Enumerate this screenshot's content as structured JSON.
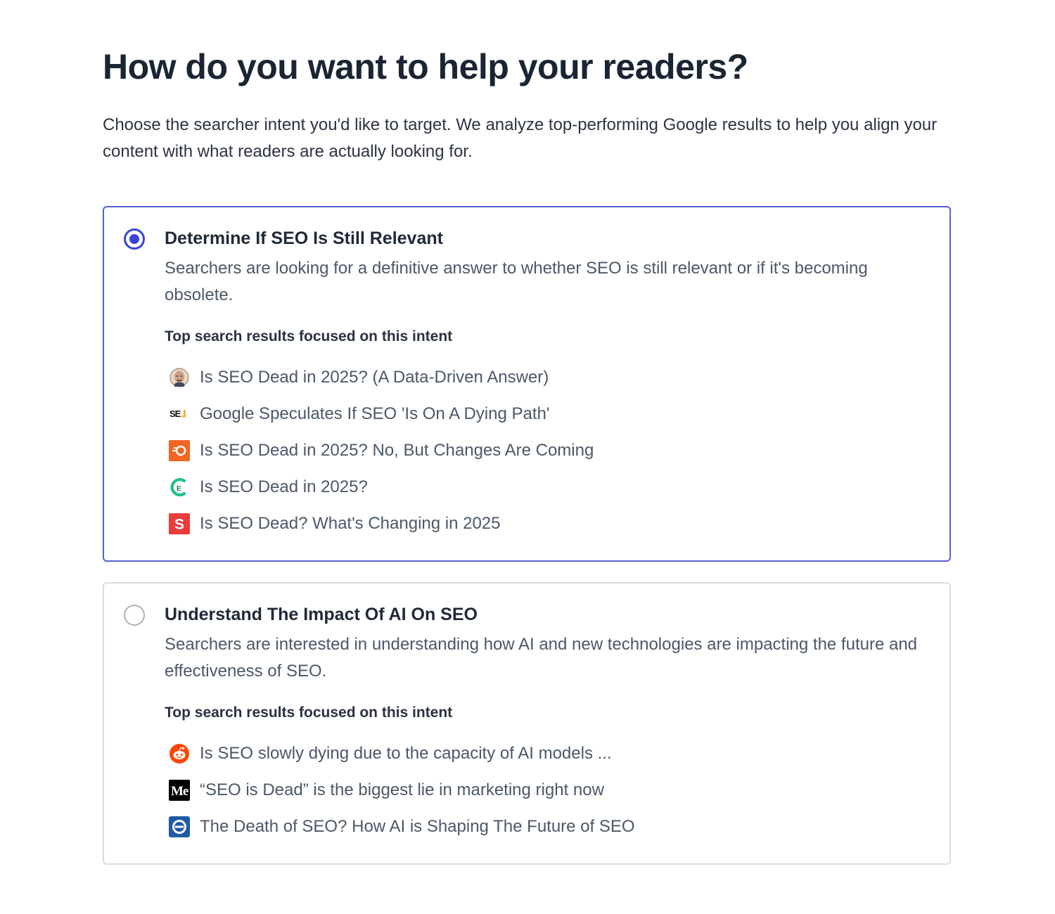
{
  "header": {
    "title": "How do you want to help your readers?",
    "subtitle": "Choose the searcher intent you'd like to target. We analyze top-performing Google results to help you align your content with what readers are actually looking for."
  },
  "colors": {
    "accent": "#3a45d6",
    "selected_border": "#5560cf",
    "unselected_border": "#d8dde4"
  },
  "intents": [
    {
      "selected": true,
      "title": "Determine If SEO Is Still Relevant",
      "description": "Searchers are looking for a definitive answer to whether SEO is still relevant or if it's becoming obsolete.",
      "results_label": "Top search results focused on this intent",
      "results": [
        {
          "icon": "person-avatar-icon",
          "title": "Is SEO Dead in 2025? (A Data-Driven Answer)"
        },
        {
          "icon": "sej-logo-icon",
          "title": "Google Speculates If SEO 'Is On A Dying Path'"
        },
        {
          "icon": "semrush-logo-icon",
          "title": "Is SEO Dead in 2025? No, But Changes Are Coming"
        },
        {
          "icon": "green-c-logo-icon",
          "title": "Is SEO Dead in 2025?"
        },
        {
          "icon": "red-s-logo-icon",
          "title": "Is SEO Dead? What's Changing in 2025"
        }
      ]
    },
    {
      "selected": false,
      "title": "Understand The Impact Of AI On SEO",
      "description": "Searchers are interested in understanding how AI and new technologies are impacting the future and effectiveness of SEO.",
      "results_label": "Top search results focused on this intent",
      "results": [
        {
          "icon": "reddit-logo-icon",
          "title": "Is SEO slowly dying due to the capacity of AI models ..."
        },
        {
          "icon": "medium-logo-icon",
          "title": "“SEO is Dead” is the biggest lie in marketing right now"
        },
        {
          "icon": "blue-circle-logo-icon",
          "title": "The Death of SEO? How AI is Shaping The Future of SEO"
        }
      ]
    }
  ]
}
